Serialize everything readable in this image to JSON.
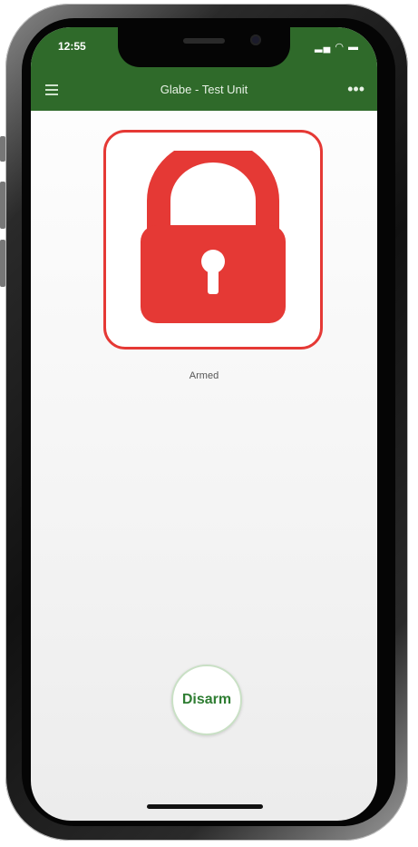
{
  "status_bar": {
    "time": "12:55",
    "icons": "▂▄ ◠ ▬"
  },
  "app_bar": {
    "title": "Glabe - Test Unit",
    "menu_icon": "hamburger-icon",
    "more_icon": "more-options-icon",
    "more_glyph": "•••"
  },
  "lock": {
    "icon": "lock-icon",
    "status_label": "Armed",
    "color": "#e53935"
  },
  "actions": {
    "disarm_label": "Disarm"
  },
  "colors": {
    "header": "#2f6a2a",
    "accent": "#2e7d32",
    "lock": "#e53935"
  }
}
